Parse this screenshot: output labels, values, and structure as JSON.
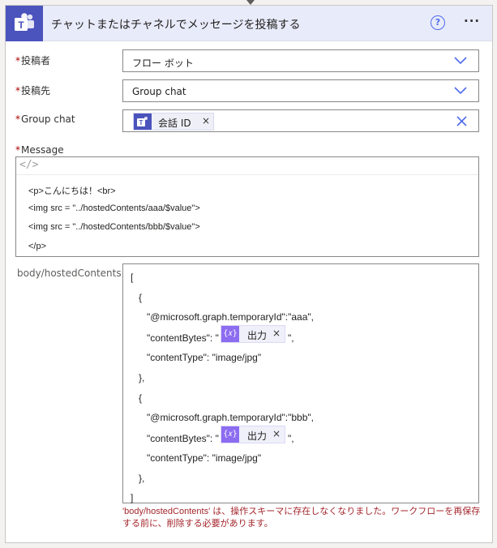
{
  "header": {
    "title": "チャットまたはチャネルでメッセージを投稿する",
    "help_symbol": "?",
    "more_symbol": "···",
    "logo_icon": "teams-icon",
    "brand_color": "#4b53bc"
  },
  "fields": {
    "poster": {
      "label": "投稿者",
      "value": "フロー ボット"
    },
    "post_in": {
      "label": "投稿先",
      "value": "Group chat"
    },
    "group_chat": {
      "label": "Group chat",
      "token_label": "会話 ID",
      "token_remove": "×"
    },
    "message": {
      "label": "Message",
      "code_symbol": "</>",
      "lines": [
        "<p>こんにちは！<br>",
        "<img src = \"../hostedContents/aaa/$value\">",
        "<img src = \"../hostedContents/bbb/$value\">",
        "</p>"
      ]
    },
    "hosted_contents": {
      "label": "body/hostedContents",
      "lines": [
        "[",
        "{",
        "\"@microsoft.graph.temporaryId\":\"aaa\",",
        "\"contentBytes\": \"",
        "\",",
        "\"contentType\": \"image/jpg\"",
        "},",
        "{",
        "\"@microsoft.graph.temporaryId\":\"bbb\",",
        "\"contentBytes\": \"",
        "\",",
        "\"contentType\": \"image/jpg\"",
        "},",
        "]"
      ],
      "expr_token_label": "出力",
      "expr_token_icon": "{𝑥}",
      "expr_token_remove": "×"
    }
  },
  "required_mark": "*",
  "error_message": "'body/hostedContents' は、操作スキーマに存在しなくなりました。ワークフローを再保存する前に、削除する必要があります。",
  "colors": {
    "accent": "#4f6bed",
    "error": "#a4262c",
    "expression": "#8c6cf0"
  }
}
